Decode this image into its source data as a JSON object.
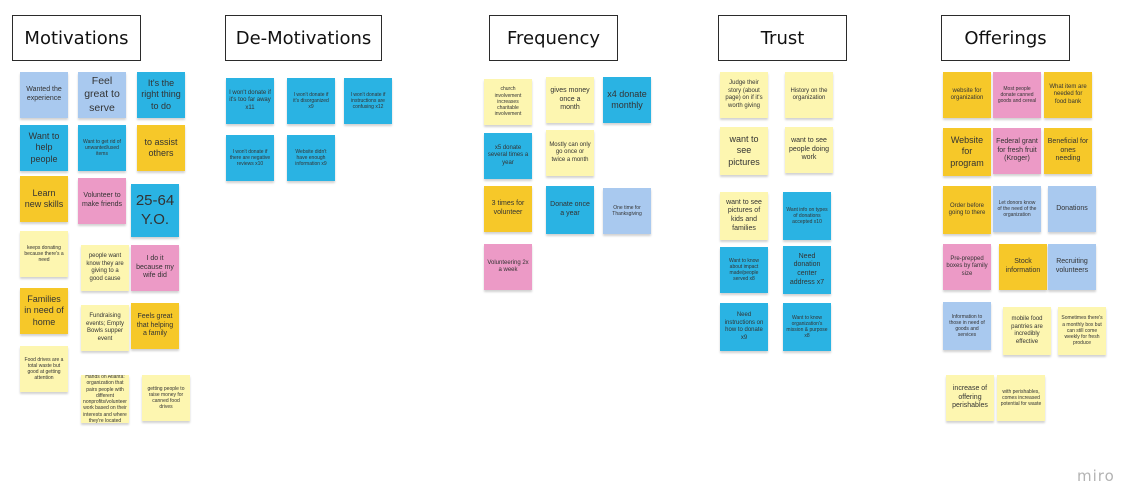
{
  "board": {
    "brand": "miro",
    "colors": {
      "light_yellow": "#fdf6b0",
      "orange": "#f6c829",
      "light_blue": "#a9c9ef",
      "cyan": "#2ab3e3",
      "pink": "#ec9ac6"
    }
  },
  "columns": {
    "motivations": {
      "title": "Motivations",
      "notes": [
        "Wanted the experience",
        "Feel great to serve",
        "It's the right thing to do",
        "Want to help people",
        "Want to get rid of unwanted/used items",
        "to assist others",
        "Learn new skills",
        "Volunteer to make friends",
        "25-64 Y.O.",
        "keeps donating because there's a need",
        "people want know they are giving to a good cause",
        "I do it because my wife did",
        "Families in need of home",
        "Fundraising events; Empty Bowls supper event",
        "Feels great that helping a family",
        "Food drives are a total waste but good at getting attention",
        "Hands on Atlanta: organization that pairs people with different nonprofits/volunteer work based on their interests and where they're located",
        "getting people to raise money for canned food drives"
      ]
    },
    "demotivations": {
      "title": "De-Motivations",
      "notes": [
        "I won't donate if it's too far away x11",
        "I won't donate if it's disorganized x9",
        "I won't donate if instructions are confusing x12",
        "I won't donate if there are negative reviews x10",
        "Website didn't have enough information x9"
      ]
    },
    "frequency": {
      "title": "Frequency",
      "notes": [
        "church involvement increases charitable involvement",
        "gives money once a month",
        "x4 donate monthly",
        "x5 donate several times a year",
        "Mostly can only go once or twice a month",
        "3 times for volunteer",
        "Donate once a year",
        "One time for Thanksgiving",
        "Volunteering 2x a week"
      ]
    },
    "trust": {
      "title": "Trust",
      "notes": [
        "Judge their story (about page) on if it's worth giving",
        "History on the organization",
        "want to see pictures",
        "want to see people doing work",
        "want to see pictures of kids and families",
        "Want info on types of donations accepted x10",
        "Want to know about impact made/people served x8",
        "Need donation center address x7",
        "Need instructions on how to donate x9",
        "Want to know organization's mission & purpose x8"
      ]
    },
    "offerings": {
      "title": "Offerings",
      "notes": [
        "website for organization",
        "Most people donate canned goods and cereal",
        "What item are needed for food bank",
        "Website for program",
        "Federal grant for fresh fruit (Kroger)",
        "Beneficial for ones needing",
        "Order before going to there",
        "Let donors know of the need of the organization",
        "Donations",
        "Pre-prepped boxes by family size",
        "Stock information",
        "Recruiting volunteers",
        "Information to those in need of goods and services",
        "mobile food pantries are incredibly effective",
        "Sometimes there's a monthly box but can still come weekly for fresh produce",
        "increase of offering perishables",
        "with perishables, comes increased potential for waste"
      ]
    }
  }
}
